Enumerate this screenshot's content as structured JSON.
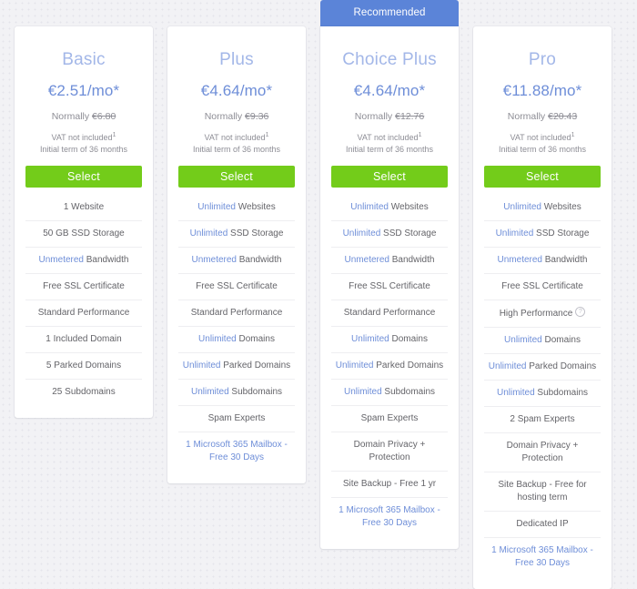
{
  "page": {
    "background_color": "#f2f2f5",
    "accent_blue": "#6e8ed8",
    "badge_blue": "#5b84d8",
    "button_green": "#73cc1a",
    "title_blue": "#a3b7e8"
  },
  "labels": {
    "recommended_badge": "Recommended",
    "normally_prefix": "Normally ",
    "vat_line": "VAT not included",
    "vat_superscript": "1",
    "term_line": "Initial term of 36 months",
    "select_label": "Select",
    "info_icon_glyph": "?"
  },
  "plans": [
    {
      "id": "basic",
      "name": "Basic",
      "price": "€2.51/mo*",
      "normally": "€6.80",
      "recommended": false,
      "features": [
        {
          "highlight": "",
          "text": "1 Website",
          "link": false
        },
        {
          "highlight": "",
          "text": "50 GB SSD Storage",
          "link": false
        },
        {
          "highlight": "Unmetered",
          "text": " Bandwidth",
          "link": false
        },
        {
          "highlight": "",
          "text": "Free SSL Certificate",
          "link": false
        },
        {
          "highlight": "",
          "text": "Standard Performance",
          "link": false
        },
        {
          "highlight": "",
          "text": "1 Included Domain",
          "link": false
        },
        {
          "highlight": "",
          "text": "5 Parked Domains",
          "link": false
        },
        {
          "highlight": "",
          "text": "25 Subdomains",
          "link": false
        }
      ]
    },
    {
      "id": "plus",
      "name": "Plus",
      "price": "€4.64/mo*",
      "normally": "€9.36",
      "recommended": false,
      "features": [
        {
          "highlight": "Unlimited",
          "text": " Websites",
          "link": false
        },
        {
          "highlight": "Unlimited",
          "text": " SSD Storage",
          "link": false
        },
        {
          "highlight": "Unmetered",
          "text": " Bandwidth",
          "link": false
        },
        {
          "highlight": "",
          "text": "Free SSL Certificate",
          "link": false
        },
        {
          "highlight": "",
          "text": "Standard Performance",
          "link": false
        },
        {
          "highlight": "Unlimited",
          "text": " Domains",
          "link": false
        },
        {
          "highlight": "Unlimited",
          "text": " Parked Domains",
          "link": false
        },
        {
          "highlight": "Unlimited",
          "text": " Subdomains",
          "link": false
        },
        {
          "highlight": "",
          "text": "Spam Experts",
          "link": false
        },
        {
          "highlight": "",
          "text": "1 Microsoft 365 Mailbox - Free 30 Days",
          "link": true
        }
      ]
    },
    {
      "id": "choice-plus",
      "name": "Choice Plus",
      "price": "€4.64/mo*",
      "normally": "€12.76",
      "recommended": true,
      "features": [
        {
          "highlight": "Unlimited",
          "text": " Websites",
          "link": false
        },
        {
          "highlight": "Unlimited",
          "text": " SSD Storage",
          "link": false
        },
        {
          "highlight": "Unmetered",
          "text": " Bandwidth",
          "link": false
        },
        {
          "highlight": "",
          "text": "Free SSL Certificate",
          "link": false
        },
        {
          "highlight": "",
          "text": "Standard Performance",
          "link": false
        },
        {
          "highlight": "Unlimited",
          "text": " Domains",
          "link": false
        },
        {
          "highlight": "Unlimited",
          "text": " Parked Domains",
          "link": false
        },
        {
          "highlight": "Unlimited",
          "text": " Subdomains",
          "link": false
        },
        {
          "highlight": "",
          "text": "Spam Experts",
          "link": false
        },
        {
          "highlight": "",
          "text": "Domain Privacy + Protection",
          "link": false
        },
        {
          "highlight": "",
          "text": "Site Backup - Free 1 yr",
          "link": false
        },
        {
          "highlight": "",
          "text": "1 Microsoft 365 Mailbox - Free 30 Days",
          "link": true
        }
      ]
    },
    {
      "id": "pro",
      "name": "Pro",
      "price": "€11.88/mo*",
      "normally": "€20.43",
      "recommended": false,
      "features": [
        {
          "highlight": "Unlimited",
          "text": " Websites",
          "link": false
        },
        {
          "highlight": "Unlimited",
          "text": " SSD Storage",
          "link": false
        },
        {
          "highlight": "Unmetered",
          "text": " Bandwidth",
          "link": false
        },
        {
          "highlight": "",
          "text": "Free SSL Certificate",
          "link": false
        },
        {
          "highlight": "",
          "text": "High Performance",
          "link": false,
          "info": true
        },
        {
          "highlight": "Unlimited",
          "text": " Domains",
          "link": false
        },
        {
          "highlight": "Unlimited",
          "text": " Parked Domains",
          "link": false
        },
        {
          "highlight": "Unlimited",
          "text": " Subdomains",
          "link": false
        },
        {
          "highlight": "",
          "text": "2 Spam Experts",
          "link": false
        },
        {
          "highlight": "",
          "text": "Domain Privacy + Protection",
          "link": false
        },
        {
          "highlight": "",
          "text": "Site Backup - Free for hosting term",
          "link": false
        },
        {
          "highlight": "",
          "text": "Dedicated IP",
          "link": false
        },
        {
          "highlight": "",
          "text": "1 Microsoft 365 Mailbox - Free 30 Days",
          "link": true
        }
      ]
    }
  ]
}
